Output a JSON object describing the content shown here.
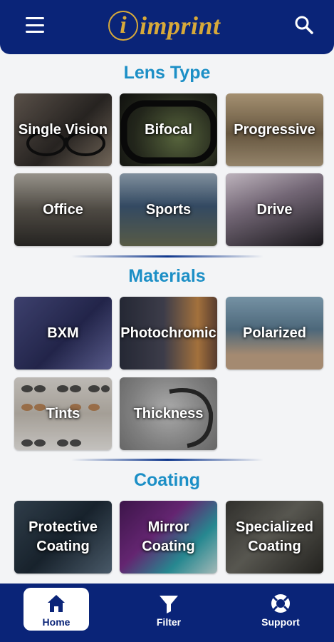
{
  "header": {
    "brand_letter": "i",
    "brand_name": "imprint"
  },
  "sections": [
    {
      "title": "Lens Type",
      "tiles": [
        "Single Vision",
        "Bifocal",
        "Progressive",
        "Office",
        "Sports",
        "Drive"
      ]
    },
    {
      "title": "Materials",
      "tiles": [
        "BXM",
        "Photochromic",
        "Polarized",
        "Tints",
        "Thickness"
      ]
    },
    {
      "title": "Coating",
      "tiles": [
        "Protective\nCoating",
        "Mirror\nCoating",
        "Specialized\nCoating"
      ]
    }
  ],
  "nav": [
    {
      "label": "Home",
      "icon": "home-icon",
      "active": true
    },
    {
      "label": "Filter",
      "icon": "filter-icon",
      "active": false
    },
    {
      "label": "Support",
      "icon": "lifebuoy-icon",
      "active": false
    }
  ],
  "colors": {
    "brand_navy": "#0a2478",
    "brand_gold": "#d7a93a",
    "section_title": "#1c8fc6"
  }
}
